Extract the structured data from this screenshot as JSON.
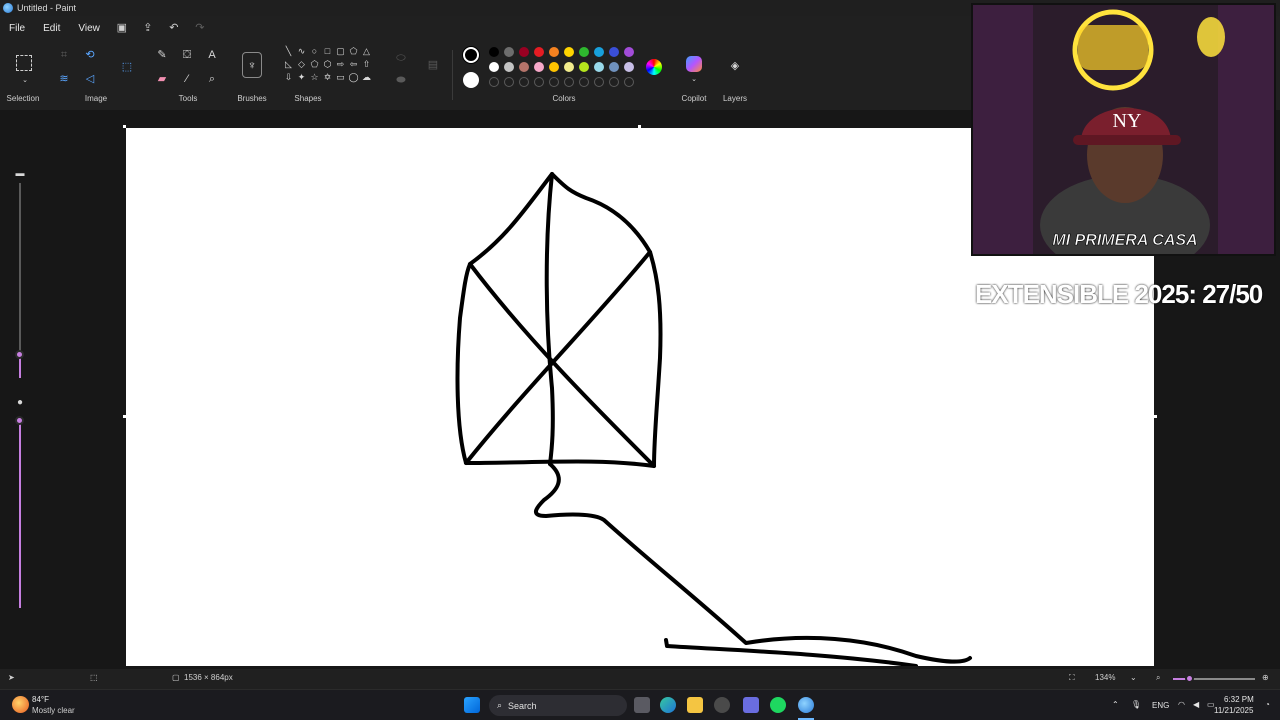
{
  "window": {
    "title": "Untitled - Paint"
  },
  "menu": {
    "file": "File",
    "edit": "Edit",
    "view": "View"
  },
  "ribbon": {
    "selection": "Selection",
    "image": "Image",
    "tools": "Tools",
    "brushes": "Brushes",
    "shapes": "Shapes",
    "colors": "Colors",
    "copilot": "Copilot",
    "layers": "Layers",
    "palette_row1": [
      "#000000",
      "#6d6d6d",
      "#990022",
      "#e51c23",
      "#f58220",
      "#ffd400",
      "#2eb82e",
      "#18a0dc",
      "#3a4fd8",
      "#a24cd8"
    ],
    "palette_row2": [
      "#ffffff",
      "#c3c3c3",
      "#b5746a",
      "#f7a8c9",
      "#ffc400",
      "#f2ec8c",
      "#b5e61d",
      "#99d9ea",
      "#7092be",
      "#c8bfe7"
    ],
    "primary_color": "#000000",
    "secondary_color": "#ffffff"
  },
  "stream_overlay": {
    "counter": "EXTENSIBLE 2025: 27/50",
    "cap_logo": "NY",
    "sign_text": "MI PRIMERA CASA"
  },
  "status": {
    "canvas_size": "1536 × 864px",
    "zoom": "134%"
  },
  "taskbar": {
    "weather_temp": "84°F",
    "weather_desc": "Mostly clear",
    "search": "Search",
    "language": "ENG",
    "time": "6:32 PM",
    "date": "11/21/2025"
  }
}
